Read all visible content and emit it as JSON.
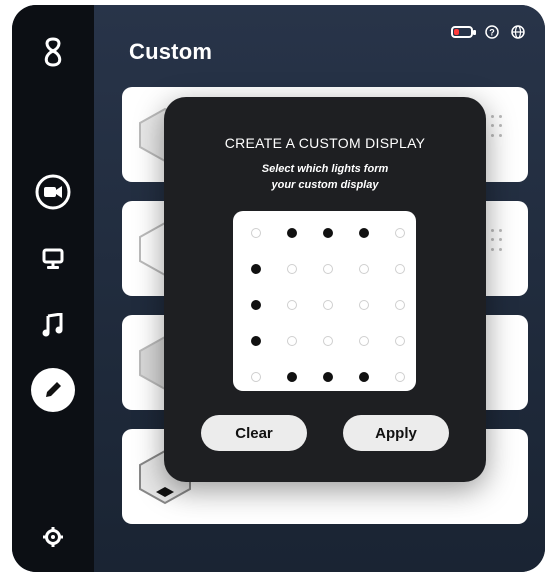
{
  "page": {
    "title": "Custom"
  },
  "sidebar": {
    "items": [
      {
        "name": "logo-icon"
      },
      {
        "name": "video-icon"
      },
      {
        "name": "monitor-icon"
      },
      {
        "name": "music-icon"
      },
      {
        "name": "pencil-icon",
        "active": true
      },
      {
        "name": "gear-icon"
      }
    ]
  },
  "topbar": {
    "battery_level": 0.3,
    "battery_color": "#ff3b3b",
    "icons": [
      "battery-icon",
      "help-icon",
      "globe-icon"
    ]
  },
  "modal": {
    "title": "CREATE A CUSTOM DISPLAY",
    "subtitle_line1": "Select which lights form",
    "subtitle_line2": "your custom display",
    "grid": [
      [
        0,
        1,
        1,
        1,
        0
      ],
      [
        1,
        0,
        0,
        0,
        0
      ],
      [
        1,
        0,
        0,
        0,
        0
      ],
      [
        1,
        0,
        0,
        0,
        0
      ],
      [
        0,
        1,
        1,
        1,
        0
      ]
    ],
    "clear_label": "Clear",
    "apply_label": "Apply"
  },
  "colors": {
    "sidebar": "#0c0f14",
    "main": "#1f2a3b",
    "modal": "#1e1f22",
    "dot_on": "#111111"
  }
}
